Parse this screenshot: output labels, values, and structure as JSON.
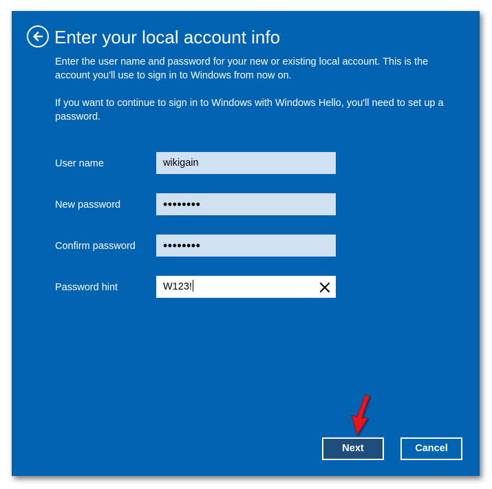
{
  "header": {
    "title": "Enter your local account info"
  },
  "description": {
    "paragraph1": "Enter the user name and password for your new or existing local account. This is the account you'll use to sign in to Windows from now on.",
    "paragraph2": "If you want to continue to sign in to Windows with Windows Hello, you'll need to set up a password."
  },
  "form": {
    "username_label": "User name",
    "username_value": "wikigain",
    "new_password_label": "New password",
    "new_password_value": "••••••••",
    "confirm_password_label": "Confirm password",
    "confirm_password_value": "••••••••",
    "hint_label": "Password hint",
    "hint_value": "W123!"
  },
  "buttons": {
    "next_label": "Next",
    "cancel_label": "Cancel"
  },
  "icons": {
    "back": "back-arrow-icon",
    "clear": "clear-x-icon",
    "annotation": "red-arrow-icon"
  },
  "colors": {
    "background": "#0063b1",
    "field_background": "#cfe0f1",
    "next_button": "#1f4d7c",
    "annotation_arrow": "#e8141b"
  }
}
